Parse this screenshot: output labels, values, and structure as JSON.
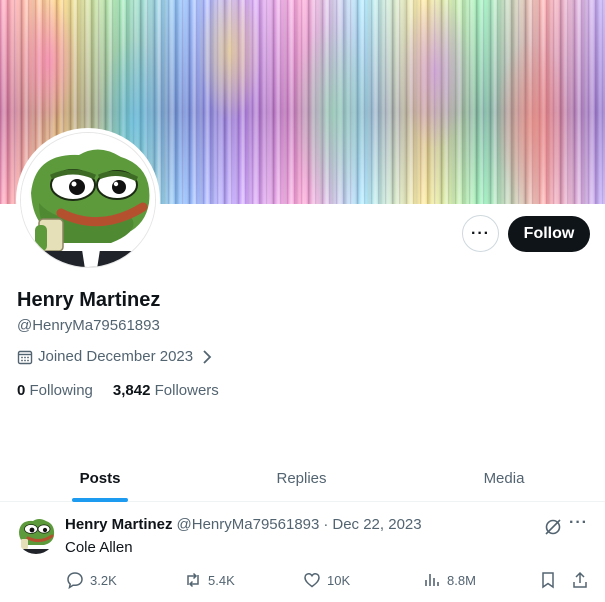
{
  "profile": {
    "name": "Henry Martinez",
    "handle": "@HenryMa79561893",
    "joined": "Joined December 2023",
    "following_count": "0",
    "following_label": "Following",
    "followers_count": "3,842",
    "followers_label": "Followers",
    "follow_label": "Follow",
    "more_label": "···"
  },
  "tabs": [
    {
      "label": "Posts",
      "active": true
    },
    {
      "label": "Replies",
      "active": false
    },
    {
      "label": "Media",
      "active": false
    }
  ],
  "post": {
    "author": "Henry Martinez",
    "handle": "@HenryMa79561893",
    "separator": "·",
    "date": "Dec 22, 2023",
    "text": "Cole Allen",
    "more_label": "···",
    "replies": "3.2K",
    "reposts": "5.4K",
    "likes": "10K",
    "views": "8.8M"
  },
  "colors": {
    "accent": "#1d9bf0",
    "text_primary": "#0f1419",
    "text_secondary": "#536471",
    "follow_button": "#0f1419"
  },
  "icons": [
    "calendar-icon",
    "chevron-right-icon",
    "more-icon",
    "grok-icon",
    "reply-icon",
    "repost-icon",
    "like-icon",
    "views-icon",
    "bookmark-icon",
    "share-icon"
  ]
}
